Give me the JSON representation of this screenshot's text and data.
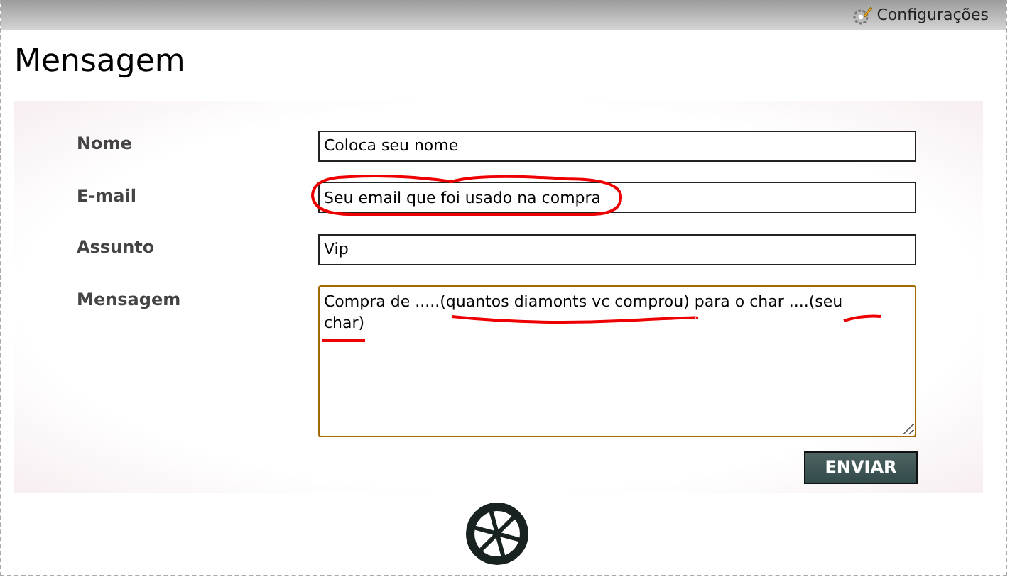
{
  "top_bar": {
    "settings_link": "Configurações"
  },
  "title": "Mensagem",
  "form": {
    "fields": [
      {
        "kind": "text",
        "label": "Nome",
        "value": "Coloca seu nome",
        "focused": false,
        "circled": false
      },
      {
        "kind": "text",
        "label": "E-mail",
        "value": "Seu email que foi usado na compra",
        "focused": false,
        "circled": true
      },
      {
        "kind": "text",
        "label": "Assunto",
        "value": "Vip",
        "focused": false,
        "circled": false
      },
      {
        "kind": "textarea",
        "label": "Mensagem",
        "value": "Compra de .....(quantos diamonts vc comprou) para o char ....(seu char)",
        "focused": true
      }
    ],
    "submit": "ENVIAR"
  }
}
